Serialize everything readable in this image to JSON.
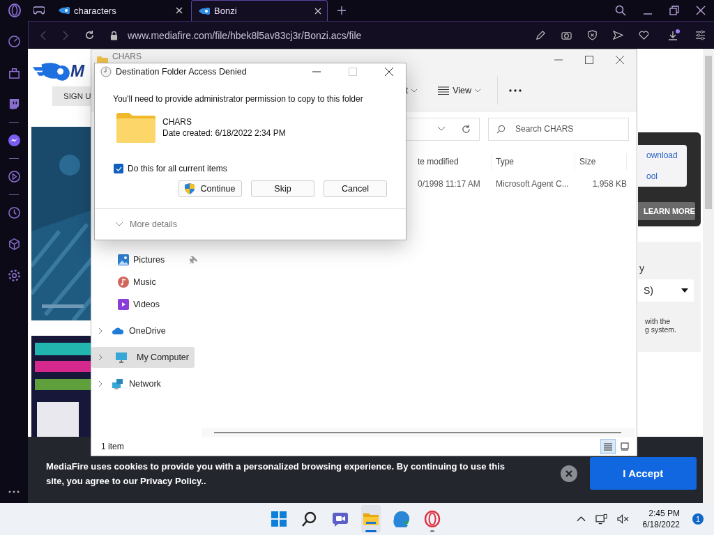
{
  "browser": {
    "tabs": [
      {
        "title": "characters",
        "selected": false
      },
      {
        "title": "Bonzi",
        "selected": true
      }
    ],
    "url": "www.mediafire.com/file/hbek8l5av83cj3r/Bonzi.acs/file"
  },
  "webpage": {
    "logo_text": "M",
    "sign_up": "SIGN U",
    "promo_links": [
      "ownload",
      "ool"
    ],
    "learn_more": "LEARN MORE",
    "panel_heading": "y",
    "select_value": "S)",
    "panel_text": [
      "with the",
      "g system."
    ],
    "cookie": {
      "text": "MediaFire uses cookies to provide you with a personalized browsing experience. By continuing to use this site, you agree to our Privacy Policy..",
      "accept": "I Accept"
    }
  },
  "explorer": {
    "title": "CHARS",
    "toolbar": [
      "t",
      "View"
    ],
    "search": {
      "placeholder": "Search CHARS"
    },
    "columns": [
      "te modified",
      "Type",
      "Size"
    ],
    "rows": [
      {
        "date": "0/1998 11:17 AM",
        "type": "Microsoft Agent C...",
        "size": "1,958 KB"
      }
    ],
    "nav": [
      {
        "label": "Pictures",
        "kind": "pictures",
        "pinned": true,
        "expandable": false,
        "selected": false
      },
      {
        "label": "Music",
        "kind": "music",
        "pinned": false,
        "expandable": false,
        "selected": false
      },
      {
        "label": "Videos",
        "kind": "videos",
        "pinned": false,
        "expandable": false,
        "selected": false
      },
      {
        "label": "OneDrive",
        "kind": "cloud",
        "pinned": false,
        "expandable": true,
        "selected": false
      },
      {
        "label": "My Computer",
        "kind": "computer",
        "pinned": false,
        "expandable": true,
        "selected": true
      },
      {
        "label": "Network",
        "kind": "network",
        "pinned": false,
        "expandable": true,
        "selected": false
      }
    ],
    "status": "1 item",
    "views": [
      {
        "kind": "details",
        "selected": true
      },
      {
        "kind": "tiles",
        "selected": false
      }
    ]
  },
  "dialog": {
    "title": "Destination Folder Access Denied",
    "maximize_disabled": true,
    "message": "You'll need to provide administrator permission to copy to this folder",
    "folder_name": "CHARS",
    "folder_date": "Date created: 6/18/2022 2:34 PM",
    "checkbox": {
      "label": "Do this for all current items",
      "checked": true
    },
    "buttons": [
      {
        "label": "Continue",
        "shield": true
      },
      {
        "label": "Skip",
        "shield": false
      },
      {
        "label": "Cancel",
        "shield": false
      }
    ],
    "more_details": "More details"
  },
  "taskbar": {
    "apps": [
      {
        "kind": "start",
        "running": false,
        "active": false
      },
      {
        "kind": "search",
        "running": false,
        "active": false
      },
      {
        "kind": "chat",
        "running": false,
        "active": false
      },
      {
        "kind": "explorer",
        "running": true,
        "active": true
      },
      {
        "kind": "edge",
        "running": false,
        "active": false
      },
      {
        "kind": "opera",
        "running": true,
        "active": false
      }
    ],
    "time": "2:45 PM",
    "date": "6/18/2022",
    "notifications": "1"
  }
}
